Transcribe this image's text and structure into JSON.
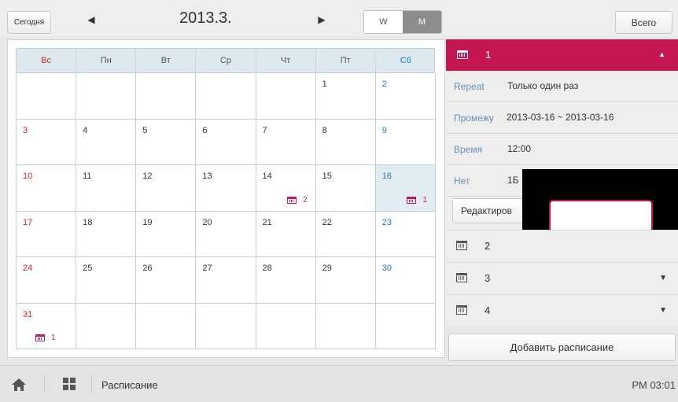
{
  "toolbar": {
    "today_label": "Сегодня",
    "prev_icon": "triangle-left-icon",
    "month_title": "2013.3.",
    "next_icon": "triangle-right-icon",
    "view_week": "W",
    "view_month": "M",
    "selected_view": "M",
    "all_label": "Всего"
  },
  "calendar": {
    "weekdays": [
      "Вс",
      "Пн",
      "Вт",
      "Ср",
      "Чт",
      "Пт",
      "Сб"
    ],
    "weeks": [
      [
        {
          "d": ""
        },
        {
          "d": ""
        },
        {
          "d": ""
        },
        {
          "d": ""
        },
        {
          "d": ""
        },
        {
          "d": "1"
        },
        {
          "d": "2"
        }
      ],
      [
        {
          "d": "3"
        },
        {
          "d": "4"
        },
        {
          "d": "5"
        },
        {
          "d": "6"
        },
        {
          "d": "7"
        },
        {
          "d": "8"
        },
        {
          "d": "9"
        }
      ],
      [
        {
          "d": "10"
        },
        {
          "d": "11"
        },
        {
          "d": "12"
        },
        {
          "d": "13"
        },
        {
          "d": "14",
          "ev": "2"
        },
        {
          "d": "15"
        },
        {
          "d": "16",
          "ev": "1",
          "hl": true
        }
      ],
      [
        {
          "d": "17"
        },
        {
          "d": "18"
        },
        {
          "d": "19"
        },
        {
          "d": "20"
        },
        {
          "d": "21"
        },
        {
          "d": "22"
        },
        {
          "d": "23"
        }
      ],
      [
        {
          "d": "24"
        },
        {
          "d": "25"
        },
        {
          "d": "26"
        },
        {
          "d": "27"
        },
        {
          "d": "28"
        },
        {
          "d": "29"
        },
        {
          "d": "30"
        }
      ],
      [
        {
          "d": "31",
          "ev": "1"
        },
        {
          "d": ""
        },
        {
          "d": ""
        },
        {
          "d": ""
        },
        {
          "d": ""
        },
        {
          "d": ""
        },
        {
          "d": ""
        }
      ]
    ]
  },
  "detail": {
    "header_number": "1",
    "repeat_label": "Repeat",
    "repeat_value": "Только один раз",
    "period_label": "Промежу",
    "period_value": "2013-03-16 ~ 2013-03-16",
    "time_label": "Время",
    "time_value": "12:00",
    "off_label": "Нет",
    "off_value": "1Б",
    "edit_label": "Редактиров"
  },
  "schedule_items": [
    {
      "number": "2",
      "caret": ""
    },
    {
      "number": "3",
      "caret": "▼"
    },
    {
      "number": "4",
      "caret": "▼"
    }
  ],
  "add_label": "Добавить расписание",
  "bottom": {
    "page_name": "Расписание",
    "clock": "PM 03:01"
  },
  "colors": {
    "accent": "#c5174f",
    "sunday": "#cc2222",
    "saturday": "#2277bb"
  }
}
